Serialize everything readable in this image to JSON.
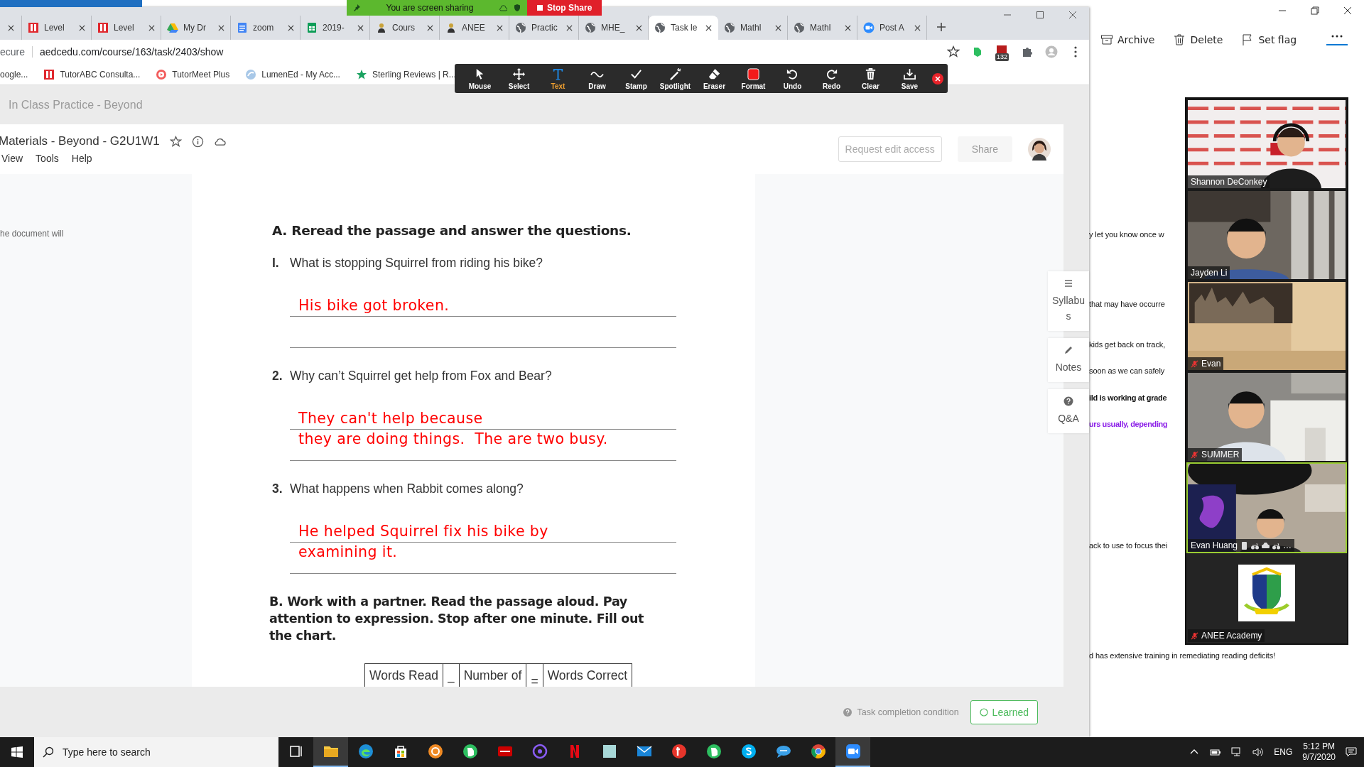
{
  "share_bar": {
    "text": "You are screen sharing",
    "stop_button": "Stop Share"
  },
  "browser": {
    "tabs": [
      {
        "label": "Level",
        "kind": "tutor",
        "selected": false
      },
      {
        "label": "Level",
        "kind": "tutor",
        "selected": false
      },
      {
        "label": "My Dr",
        "kind": "drive",
        "selected": false
      },
      {
        "label": "zoom",
        "kind": "docs",
        "selected": false
      },
      {
        "label": "2019-",
        "kind": "sheets",
        "selected": false
      },
      {
        "label": "Cours",
        "kind": "person",
        "selected": false
      },
      {
        "label": "ANEE",
        "kind": "person",
        "selected": false
      },
      {
        "label": "Practic",
        "kind": "globe",
        "selected": false
      },
      {
        "label": "MHE_",
        "kind": "globe",
        "selected": false
      },
      {
        "label": "Task le",
        "kind": "globe",
        "selected": true
      },
      {
        "label": "Mathl",
        "kind": "globe",
        "selected": false
      },
      {
        "label": "Mathl",
        "kind": "globe",
        "selected": false
      },
      {
        "label": "Post A",
        "kind": "zoom",
        "selected": false
      }
    ],
    "address": {
      "security": "ecure",
      "url": "aedcedu.com/course/163/task/2403/show",
      "badge": "132"
    },
    "bookmarks": [
      {
        "label": "oogle...",
        "kind": "none"
      },
      {
        "label": "TutorABC Consulta...",
        "kind": "tutor"
      },
      {
        "label": "TutorMeet Plus",
        "kind": "meet"
      },
      {
        "label": "LumenEd - My Acc...",
        "kind": "lumen"
      },
      {
        "label": "Sterling Reviews | R...",
        "kind": "star"
      }
    ],
    "annotation_tools": [
      {
        "label": "Mouse",
        "kind": "mouse",
        "selected": false
      },
      {
        "label": "Select",
        "kind": "select",
        "selected": false
      },
      {
        "label": "Text",
        "kind": "text",
        "selected": true
      },
      {
        "label": "Draw",
        "kind": "draw",
        "selected": false
      },
      {
        "label": "Stamp",
        "kind": "stamp",
        "selected": false
      },
      {
        "label": "Spotlight",
        "kind": "spotlight",
        "selected": false
      },
      {
        "label": "Eraser",
        "kind": "eraser",
        "selected": false
      },
      {
        "label": "Format",
        "kind": "format",
        "selected": false
      },
      {
        "label": "Undo",
        "kind": "undo",
        "selected": false
      },
      {
        "label": "Redo",
        "kind": "redo",
        "selected": false
      },
      {
        "label": "Clear",
        "kind": "clear",
        "selected": false
      },
      {
        "label": "Save",
        "kind": "save",
        "selected": false
      }
    ],
    "breadcrumb": "In Class Practice - Beyond",
    "document": {
      "title": "Materials - Beyond - G2U1W1",
      "menu": [
        "View",
        "Tools",
        "Help"
      ],
      "request_button": "Request edit access",
      "share_button": "Share",
      "side_note": "he document will"
    },
    "worksheet": {
      "heading": "A. Reread the passage and answer the questions.",
      "questions": [
        {
          "number": "I.",
          "text": "What is stopping Squirrel from riding his bike?",
          "answer": [
            "His bike got broken."
          ]
        },
        {
          "number": "2.",
          "text": "Why can’t Squirrel get help from Fox and Bear?",
          "answer": [
            "They can't help because",
            "they are doing things.  The are two busy."
          ]
        },
        {
          "number": "3.",
          "text": "What happens when Rabbit comes along?",
          "answer": [
            "He helped Squirrel fix his bike by",
            "examining it."
          ]
        }
      ],
      "part_b": "B. Work with a partner. Read the passage aloud. Pay attention to expression. Stop after one minute. Fill out the chart.",
      "table_cells": [
        {
          "text": "Words Read",
          "kind": "label"
        },
        {
          "text": "–",
          "kind": "operator"
        },
        {
          "text": "Number of",
          "kind": "label"
        },
        {
          "text": "=",
          "kind": "operator"
        },
        {
          "text": "Words Correct",
          "kind": "label"
        }
      ]
    },
    "side_buttons": [
      {
        "label": "Syllabus",
        "kind": "menu"
      },
      {
        "label": "Notes",
        "kind": "pencil"
      },
      {
        "label": "Q&A",
        "kind": "help"
      }
    ],
    "footer": {
      "condition": "Task completion condition",
      "learned_button": "Learned"
    }
  },
  "mail": {
    "toolbar": [
      {
        "label": "Archive",
        "kind": "archive"
      },
      {
        "label": "Delete",
        "kind": "delete"
      },
      {
        "label": "Set flag",
        "kind": "flag"
      }
    ],
    "lines": [
      {
        "text": "y let you know once w",
        "kind": "normal"
      },
      {
        "text": "that may have occurre",
        "kind": "normal"
      },
      {
        "text": "kids get back on track,",
        "kind": "normal"
      },
      {
        "text": "soon as we can safely",
        "kind": "normal"
      },
      {
        "text": "ild is working at grade",
        "kind": "bold"
      },
      {
        "text": "urs usually, depending",
        "kind": "highlight"
      },
      {
        "text": "ack to use to focus thei",
        "kind": "normal"
      },
      {
        "text": "d has extensive training in remediating reading deficits!",
        "kind": "normal"
      }
    ]
  },
  "meeting": {
    "participants": [
      {
        "name": "Shannon DeConkey",
        "kind": "video",
        "muted": false,
        "active": false
      },
      {
        "name": "Jayden Li",
        "kind": "video",
        "muted": false,
        "active": false
      },
      {
        "name": "Evan",
        "kind": "video",
        "muted": true,
        "active": false
      },
      {
        "name": "SUMMER",
        "kind": "video",
        "muted": true,
        "active": false
      },
      {
        "name": "Evan Huang",
        "suffix": "…",
        "kind": "video",
        "muted": false,
        "active": true
      },
      {
        "name": "ANEE Academy",
        "kind": "logo",
        "muted": true,
        "active": false
      }
    ]
  },
  "taskbar": {
    "search_placeholder": "Type here to search",
    "apps": [
      {
        "kind": "taskview",
        "selected": false
      },
      {
        "kind": "folder",
        "selected": true
      },
      {
        "kind": "edge",
        "selected": false
      },
      {
        "kind": "store",
        "selected": false
      },
      {
        "kind": "orange",
        "selected": false
      },
      {
        "kind": "green",
        "selected": false
      },
      {
        "kind": "red",
        "selected": false
      },
      {
        "kind": "purple",
        "selected": false
      },
      {
        "kind": "netflix",
        "selected": false
      },
      {
        "kind": "square",
        "selected": false
      },
      {
        "kind": "mail",
        "selected": false
      },
      {
        "kind": "redcircle",
        "selected": false
      },
      {
        "kind": "green",
        "selected": false
      },
      {
        "kind": "skype",
        "selected": false
      },
      {
        "kind": "bubble",
        "selected": false
      },
      {
        "kind": "chrome",
        "selected": false
      },
      {
        "kind": "zoom",
        "selected": true
      }
    ],
    "language": "ENG",
    "time": "5:12 PM",
    "date": "9/7/2020"
  }
}
